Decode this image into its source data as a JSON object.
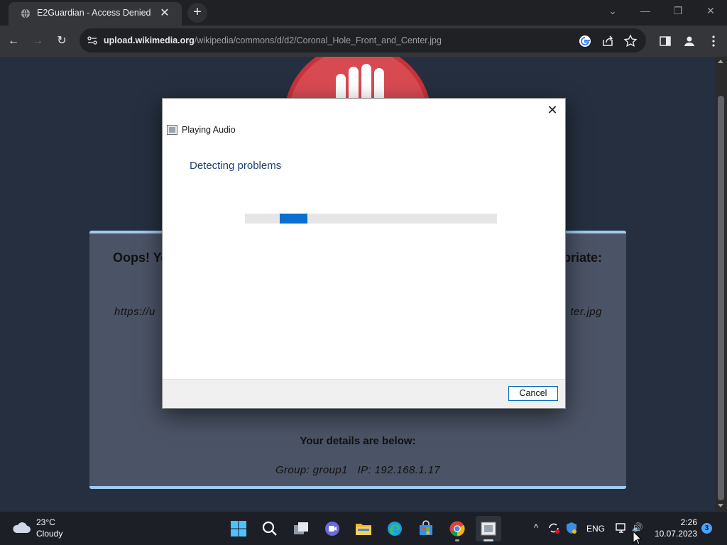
{
  "browser": {
    "tab": {
      "title": "E2Guardian - Access Denied",
      "close": "✕"
    },
    "new_tab": "+",
    "window_controls": {
      "dropdown": "⌄",
      "minimize": "—",
      "restore": "❐",
      "close": "✕"
    },
    "nav": {
      "back": "←",
      "forward": "→",
      "reload": "↻"
    },
    "url": {
      "host": "upload.wikimedia.org",
      "path": "/wikipedia/commons/d/d2/Coronal_Hole_Front_and_Center.jpg"
    }
  },
  "page": {
    "message_start": "Oops! Yo",
    "message_end": "priate:",
    "blocked_url_start": "https://u",
    "blocked_url_end": "ter.jpg",
    "details_title": "Your details are below:",
    "details_line": "Group: group1   IP: 192.168.1.17"
  },
  "dialog": {
    "title": "Playing Audio",
    "close": "✕",
    "heading": "Detecting problems",
    "progress": {
      "fill_start": 0.138,
      "fill_fraction": 0.11
    },
    "cancel_label": "Cancel"
  },
  "taskbar": {
    "weather": {
      "temp": "23°C",
      "condition": "Cloudy"
    },
    "tray": {
      "chevron": "^",
      "lang": "ENG",
      "volume": "🔊"
    },
    "clock": {
      "time": "2:26",
      "date": "10.07.2023"
    },
    "notifications": "3"
  },
  "colors": {
    "accent": "#0a6fd1",
    "heading": "#1e3f73",
    "panel_border": "#9ecbf2"
  }
}
